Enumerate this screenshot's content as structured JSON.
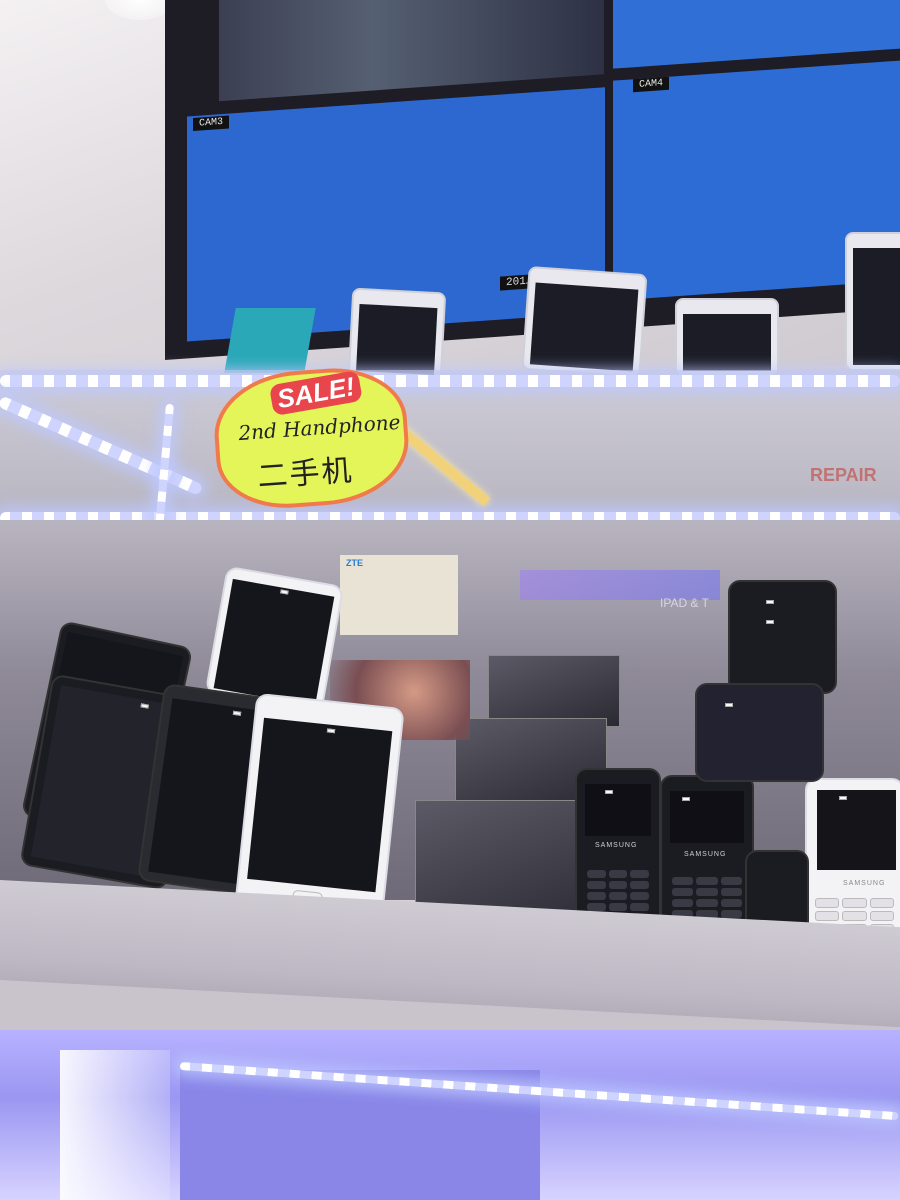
{
  "scene": {
    "description_labels": {
      "cam3": "CAM3",
      "cam4": "CAM4",
      "timestamp": "201… …8:09"
    },
    "sale_sign": {
      "headline": "SALE!",
      "line1": "2nd Handphone",
      "line2": "二手机"
    },
    "background_text": {
      "repair": "REPAIR",
      "ipad": "IPAD & T",
      "poster_brand": "ZTE"
    },
    "brand_on_phones": [
      "SAMSUNG",
      "SAMSUNG",
      "SAMSUNG"
    ]
  },
  "colors": {
    "monitor_blue": "#2c68d0",
    "sign_yellow": "#e4f55a",
    "sign_border": "#f07a4c",
    "sale_red": "#e8464c",
    "led_white": "#ffffff",
    "lower_glow": "#b7b2ff"
  }
}
